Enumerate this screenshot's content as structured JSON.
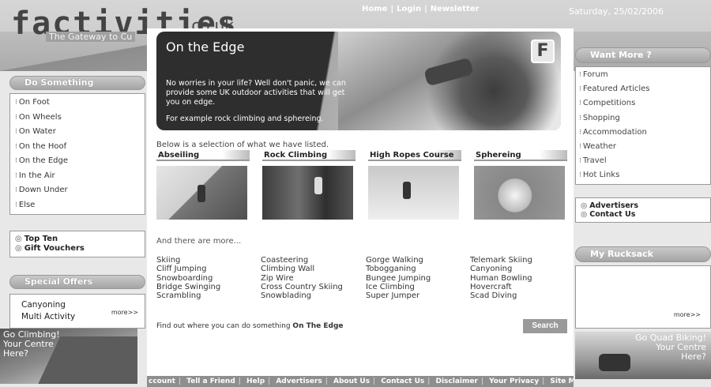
{
  "header": {
    "logo": "factivities",
    "logo_suffix": ".co.uk",
    "tagline": "The Gateway to Cu",
    "nav": [
      "Home",
      "Login",
      "Newsletter"
    ],
    "date": "Saturday, 25/02/2006"
  },
  "left": {
    "do_something_title": "Do Something",
    "menu": [
      "On Foot",
      "On Wheels",
      "On Water",
      "On the Hoof",
      "On the Edge",
      "In the Air",
      "Down Under",
      "Else"
    ],
    "links": [
      "Top Ten",
      "Gift Vouchers"
    ],
    "special_offers_title": "Special Offers",
    "offers": [
      "Canyoning",
      "Multi Activity"
    ],
    "offers_more": "more>>",
    "promo_text": [
      "Go Climbing!",
      "Your Centre",
      "Here?"
    ]
  },
  "hero": {
    "title": "On the Edge",
    "para1": "No worries in your life? Well don't panic, we can provide some UK outdoor activities that will get you on edge.",
    "para2": "For example rock climbing and sphereing.",
    "badge": "F"
  },
  "main": {
    "intro": "Below is a selection of what we have listed.",
    "activities": [
      "Abseiling",
      "Rock Climbing",
      "High Ropes Course",
      "Sphereing"
    ],
    "more_label": "And there are more...",
    "more_columns": [
      [
        "Skiing",
        "Cliff Jumping",
        "Snowboarding",
        "Bridge Swinging",
        "Scrambling"
      ],
      [
        "Coasteering",
        "Climbing Wall",
        "Zip Wire",
        "Cross Country Skiing",
        "Snowblading"
      ],
      [
        "Gorge Walking",
        "Tobogganing",
        "Bungee Jumping",
        "Ice Climbing",
        "Super Jumper"
      ],
      [
        "Telemark Skiing",
        "Canyoning",
        "Human Bowling",
        "Hovercraft",
        "Scad Diving"
      ]
    ],
    "find_prefix": "Find out where you can do something ",
    "find_bold": "On The Edge",
    "search_label": "Search"
  },
  "right": {
    "want_more_title": "Want More ?",
    "links": [
      "Forum",
      "Featured Articles",
      "Competitions",
      "Shopping",
      "Accommodation",
      "Weather",
      "Travel",
      "Hot Links"
    ],
    "adv_links": [
      "Advertisers",
      "Contact Us"
    ],
    "rucksack_title": "My Rucksack",
    "rucksack_more": "more>>",
    "quad_text": [
      "Go Quad Biking!",
      "Your Centre",
      "Here?"
    ]
  },
  "footer": {
    "links": [
      "ccount",
      "Tell a Friend",
      "Help",
      "Advertisers",
      "About Us",
      "Contact Us",
      "Disclaimer",
      "Your Privacy",
      "Site M"
    ]
  }
}
